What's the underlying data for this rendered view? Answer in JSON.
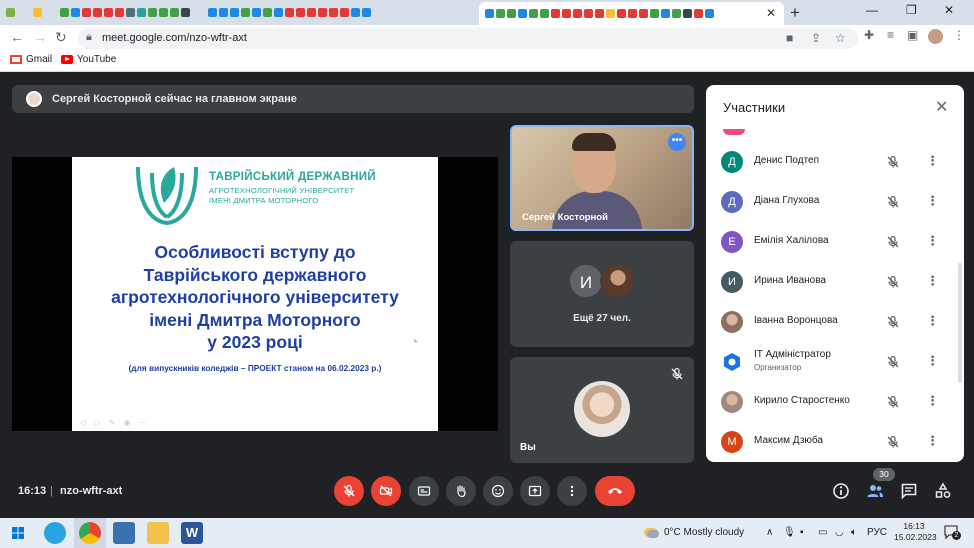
{
  "browser": {
    "active_tab_close": "✕",
    "new_tab": "+",
    "url": "meet.google.com/nzo-wftr-axt",
    "bookmarks": [
      {
        "label": "Gmail"
      },
      {
        "label": "YouTube"
      }
    ]
  },
  "meet": {
    "notice": "Сергей Косторной сейчас на главном экране",
    "slide": {
      "university_line1": "ТАВРІЙСЬКИЙ ДЕРЖАВНИЙ",
      "university_line2": "АГРОТЕХНОЛОГІЧНИЙ УНІВЕРСИТЕТ",
      "university_line3": "ІМЕНІ ДМИТРА МОТОРНОГО",
      "title_lines": [
        "Особливості вступу до",
        "Таврійського державного",
        "агротехнологічного університету",
        "імені Дмитра Моторного",
        "у 2023 році"
      ],
      "subtitle": "(для випускників коледжів – ПРОЕКТ станом на 06.02.2023 р.)"
    },
    "tiles": {
      "presenter_name": "Сергей Косторной",
      "more_avatar_letter": "И",
      "more_label": "Ещё 27 чел.",
      "you_label": "Вы"
    },
    "panel": {
      "title": "Участники",
      "participants": [
        {
          "initial": "Д",
          "name": "Денис Подтеп",
          "color": "#00897b"
        },
        {
          "initial": "Д",
          "name": "Діана Глухова",
          "color": "#5c6bc0"
        },
        {
          "initial": "Е",
          "name": "Емілія Халілова",
          "color": "#7e57c2"
        },
        {
          "initial": "И",
          "name": "Ирина Иванова",
          "color": "#455a64"
        },
        {
          "initial": "",
          "name": "Іванна Воронцова",
          "color": "#8d6e63"
        },
        {
          "initial": "",
          "name": "IT Адміністратор",
          "role": "Организатор",
          "color": "#ffffff"
        },
        {
          "initial": "",
          "name": "Кирило Старостенко",
          "color": "#a1887f"
        },
        {
          "initial": "М",
          "name": "Максим Дзюба",
          "color": "#d84315"
        }
      ]
    },
    "toolbar": {
      "time": "16:13",
      "separator": "|",
      "meeting_code": "nzo-wftr-axt",
      "participant_count": "30"
    }
  },
  "taskbar": {
    "weather": "0°C  Mostly cloudy",
    "language": "РУС",
    "clock_time": "16:13",
    "clock_date": "15.02.2023",
    "notifications": "2"
  },
  "colors": {
    "meet_bg": "#202124",
    "tile_bg": "#3c4043",
    "danger": "#ea4335",
    "slide_title": "#1f3fa8",
    "logo_teal": "#2aa89b"
  }
}
